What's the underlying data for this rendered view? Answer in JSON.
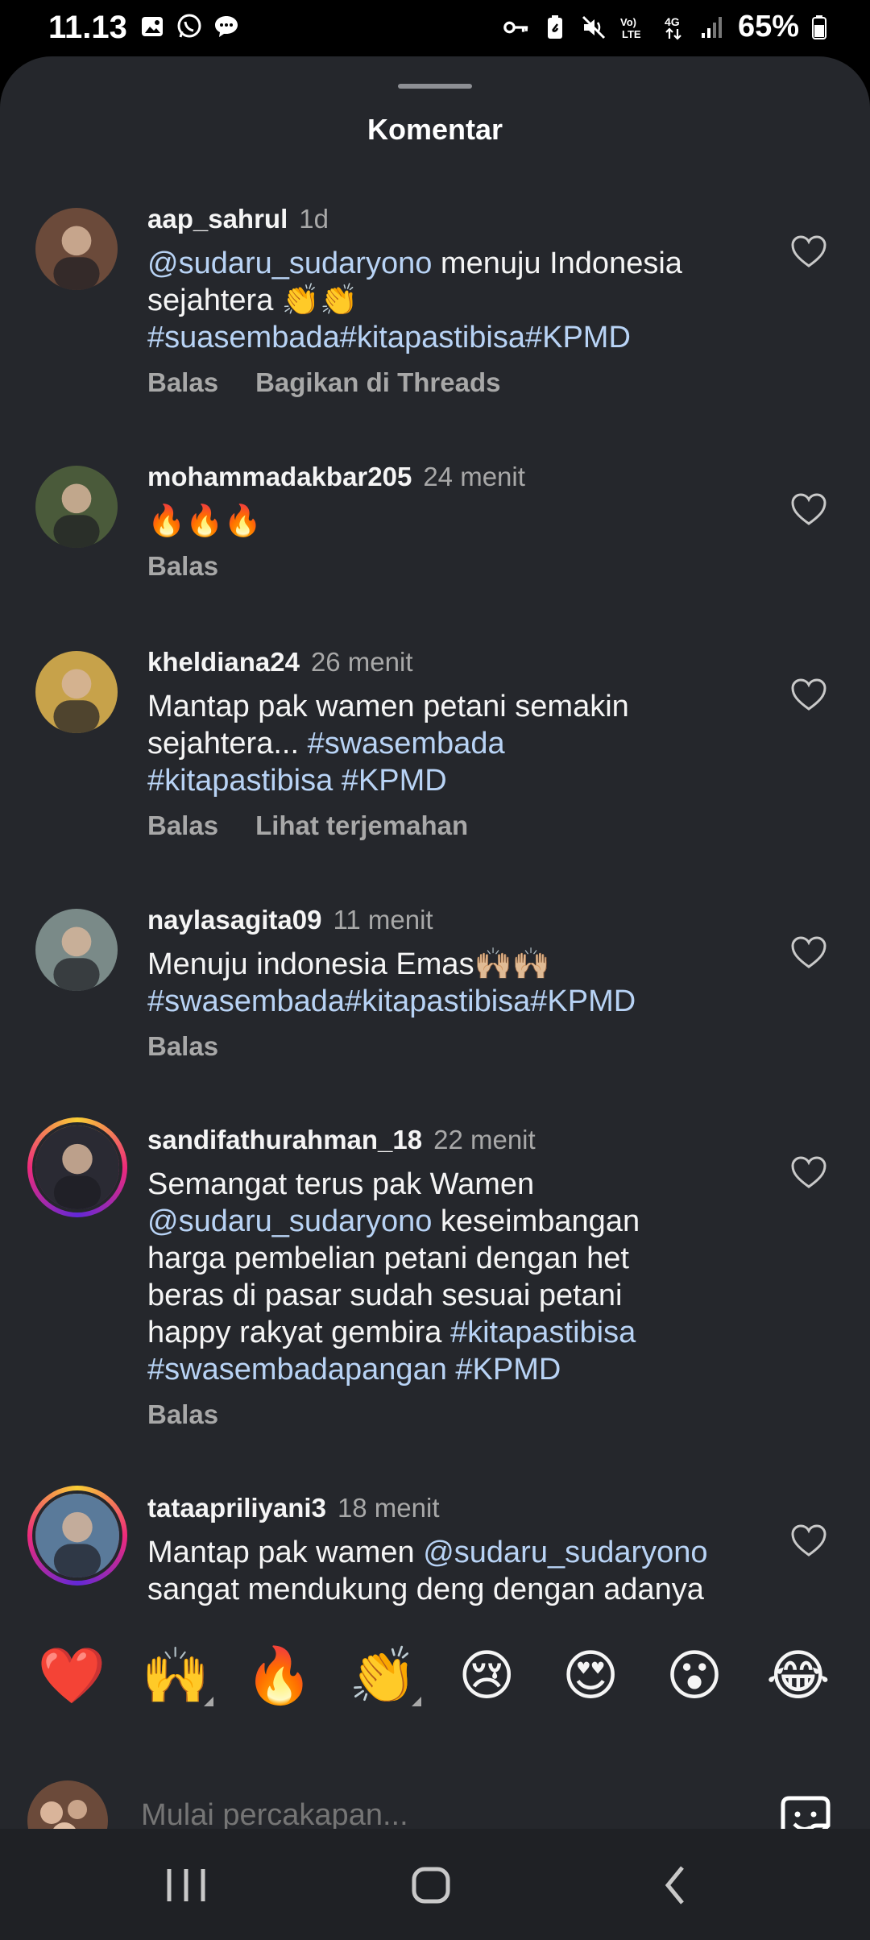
{
  "status_bar": {
    "time": "11.13",
    "battery": "65%",
    "left_icons": [
      "gallery-icon",
      "whatsapp-icon",
      "message-icon"
    ],
    "right_icons": [
      "vpn-key-icon",
      "battery-saver-icon",
      "mute-icon",
      "volte-icon",
      "4g-icon",
      "signal-icon",
      "battery-icon"
    ]
  },
  "sheet": {
    "title": "Komentar"
  },
  "comments": [
    {
      "user": "aap_sahrul",
      "time": "1d",
      "segments": [
        {
          "t": "@sudaru_sudaryono",
          "link": true
        },
        {
          "t": " menuju Indonesia\nsejahtera 👏👏\n",
          "link": false
        },
        {
          "t": "#suasembada#kitapastibisa#KPMD",
          "link": true
        }
      ],
      "actions": [
        "Balas",
        "Bagikan di Threads"
      ],
      "avatar_color": "#6b4a3a",
      "ring": false
    },
    {
      "user": "mohammadakbar205",
      "time": "24 menit",
      "segments": [
        {
          "t": "🔥🔥🔥",
          "link": false
        }
      ],
      "actions": [
        "Balas"
      ],
      "avatar_color": "#4a5a3a",
      "ring": false
    },
    {
      "user": "kheldiana24",
      "time": "26 menit",
      "segments": [
        {
          "t": "Mantap pak wamen petani semakin\nsejahtera... ",
          "link": false
        },
        {
          "t": "#swasembada\n#kitapastibisa #KPMD",
          "link": true
        }
      ],
      "actions": [
        "Balas",
        "Lihat terjemahan"
      ],
      "avatar_color": "#c7a24a",
      "ring": false
    },
    {
      "user": "naylasagita09",
      "time": "11 menit",
      "segments": [
        {
          "t": "Menuju indonesia Emas🙌🏼🙌🏼\n",
          "link": false
        },
        {
          "t": "#swasembada#kitapastibisa#KPMD",
          "link": true
        }
      ],
      "actions": [
        "Balas"
      ],
      "avatar_color": "#7a8a88",
      "ring": false
    },
    {
      "user": "sandifathurahman_18",
      "time": "22 menit",
      "segments": [
        {
          "t": "Semangat terus pak Wamen\n",
          "link": false
        },
        {
          "t": "@sudaru_sudaryono",
          "link": true
        },
        {
          "t": " keseimbangan\nharga pembelian petani dengan het\nberas di pasar sudah sesuai petani\nhappy rakyat gembira ",
          "link": false
        },
        {
          "t": "#kitapastibisa\n#swasembadapangan #KPMD",
          "link": true
        }
      ],
      "actions": [
        "Balas"
      ],
      "avatar_color": "#2a2a33",
      "ring": true
    },
    {
      "user": "tataapriliyani3",
      "time": "18 menit",
      "segments": [
        {
          "t": "Mantap pak wamen ",
          "link": false
        },
        {
          "t": "@sudaru_sudaryono",
          "link": true
        },
        {
          "t": "\nsangat mendukung deng dengan adanya",
          "link": false
        }
      ],
      "actions": [],
      "avatar_color": "#5a7a9a",
      "ring": true
    }
  ],
  "emoji_bar": [
    "❤️",
    "🙌",
    "🔥",
    "👏",
    "😢",
    "😍",
    "😮",
    "😂"
  ],
  "input": {
    "placeholder": "Mulai percakapan..."
  },
  "nav": [
    "recent-apps-icon",
    "home-icon",
    "back-icon"
  ]
}
